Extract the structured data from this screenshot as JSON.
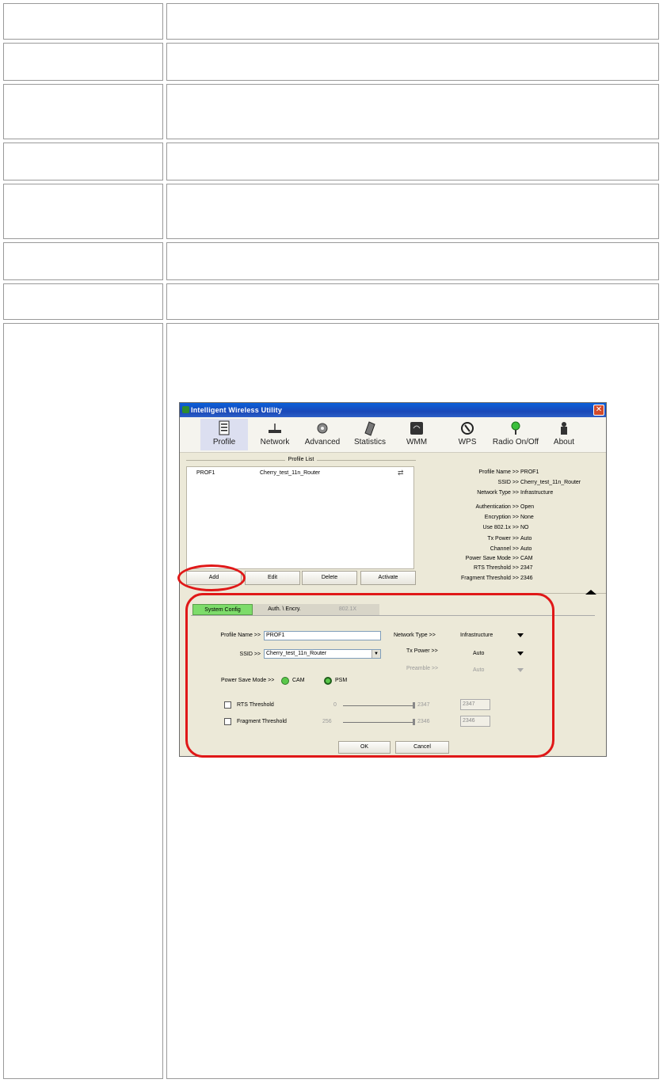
{
  "window": {
    "title": "Intelligent Wireless Utility"
  },
  "toolbar": {
    "items": [
      {
        "label": "Profile",
        "icon": "profile-icon"
      },
      {
        "label": "Network",
        "icon": "network-icon"
      },
      {
        "label": "Advanced",
        "icon": "advanced-icon"
      },
      {
        "label": "Statistics",
        "icon": "statistics-icon"
      },
      {
        "label": "WMM",
        "icon": "wmm-icon"
      },
      {
        "label": "WPS",
        "icon": "wps-icon"
      },
      {
        "label": "Radio On/Off",
        "icon": "radio-icon"
      },
      {
        "label": "About",
        "icon": "about-icon"
      }
    ]
  },
  "profile_list": {
    "title": "Profile List",
    "rows": [
      {
        "name": "PROF1",
        "ssid": "Cherry_test_11n_Router"
      }
    ],
    "buttons": {
      "add": "Add",
      "edit": "Edit",
      "delete": "Delete",
      "activate": "Activate"
    }
  },
  "profile_info": [
    {
      "label": "Profile Name >>",
      "value": "PROF1"
    },
    {
      "label": "SSID >>",
      "value": "Cherry_test_11n_Router"
    },
    {
      "label": "Network Type >>",
      "value": "Infrastructure"
    },
    {
      "label": "Authentication >>",
      "value": "Open"
    },
    {
      "label": "Encryption >>",
      "value": "None"
    },
    {
      "label": "Use 802.1x >>",
      "value": "NO"
    },
    {
      "label": "Tx Power >>",
      "value": "Auto"
    },
    {
      "label": "Channel >>",
      "value": "Auto"
    },
    {
      "label": "Power Save Mode >>",
      "value": "CAM"
    },
    {
      "label": "RTS Threshold >>",
      "value": "2347"
    },
    {
      "label": "Fragment Threshold >>",
      "value": "2346"
    }
  ],
  "config": {
    "tabs": {
      "system": "System Config",
      "auth": "Auth. \\ Encry.",
      "x8021": "802.1X"
    },
    "profile_name_label": "Profile Name >>",
    "profile_name_value": "PROF1",
    "ssid_label": "SSID >>",
    "ssid_value": "Cherry_test_11n_Router",
    "network_type_label": "Network Type >>",
    "network_type_value": "Infrastructure",
    "tx_power_label": "Tx Power >>",
    "tx_power_value": "Auto",
    "preamble_label": "Preamble >>",
    "preamble_value": "Auto",
    "power_save_label": "Power Save Mode >>",
    "cam_label": "CAM",
    "psm_label": "PSM",
    "rts_label": "RTS Threshold",
    "rts_min": "0",
    "rts_max": "2347",
    "rts_value": "2347",
    "frag_label": "Fragment Threshold",
    "frag_min": "256",
    "frag_max": "2346",
    "frag_value": "2346",
    "ok": "OK",
    "cancel": "Cancel"
  },
  "colors": {
    "highlight": "#e01818",
    "active_tab": "#7ddc6a",
    "titlebar": "#0a5fd8"
  }
}
